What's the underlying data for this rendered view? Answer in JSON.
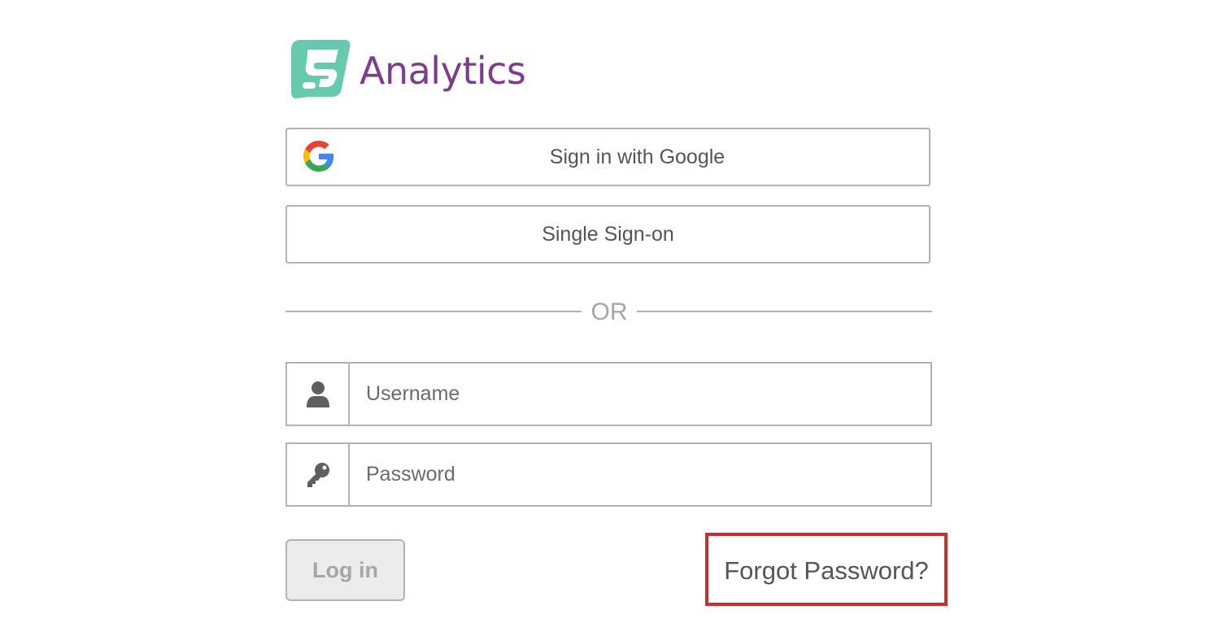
{
  "logo": {
    "text": "Analytics",
    "mark_color": "#67c9ad",
    "text_color": "#7d3d8c"
  },
  "sso": {
    "google_label": "Sign in with Google",
    "single_sign_on_label": "Single Sign-on"
  },
  "divider": {
    "text": "OR"
  },
  "form": {
    "username_placeholder": "Username",
    "password_placeholder": "Password",
    "login_label": "Log in",
    "forgot_password_label": "Forgot Password?"
  },
  "colors": {
    "border": "#b3b3b3",
    "highlight": "#c9302c"
  }
}
